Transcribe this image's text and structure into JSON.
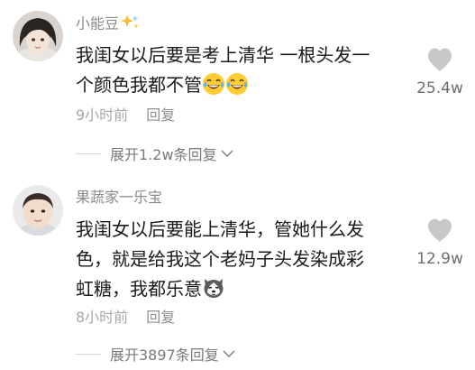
{
  "comments": [
    {
      "username": "小能豆",
      "badge_icon": "sparkle-badge-icon",
      "lines": [
        "我闺女以后要是考上清华 一根头发一",
        "个颜色我都不管"
      ],
      "emojis": [
        "laughing-tears-emoji-icon",
        "laughing-tears-emoji-icon"
      ],
      "time": "9小时前",
      "reply_label": "回复",
      "like_count": "25.4w",
      "expand_label": "展开1.2w条回复"
    },
    {
      "username": "果蔬家一乐宝",
      "lines": [
        "我闺女以后要能上清华，管她什么发",
        "色，就是给我这个老妈子头发染成彩",
        "虹糖，我都乐意"
      ],
      "emojis": [
        "husky-dog-emoji-icon"
      ],
      "time": "8小时前",
      "reply_label": "回复",
      "like_count": "12.9w",
      "expand_label": "展开3897条回复"
    }
  ]
}
